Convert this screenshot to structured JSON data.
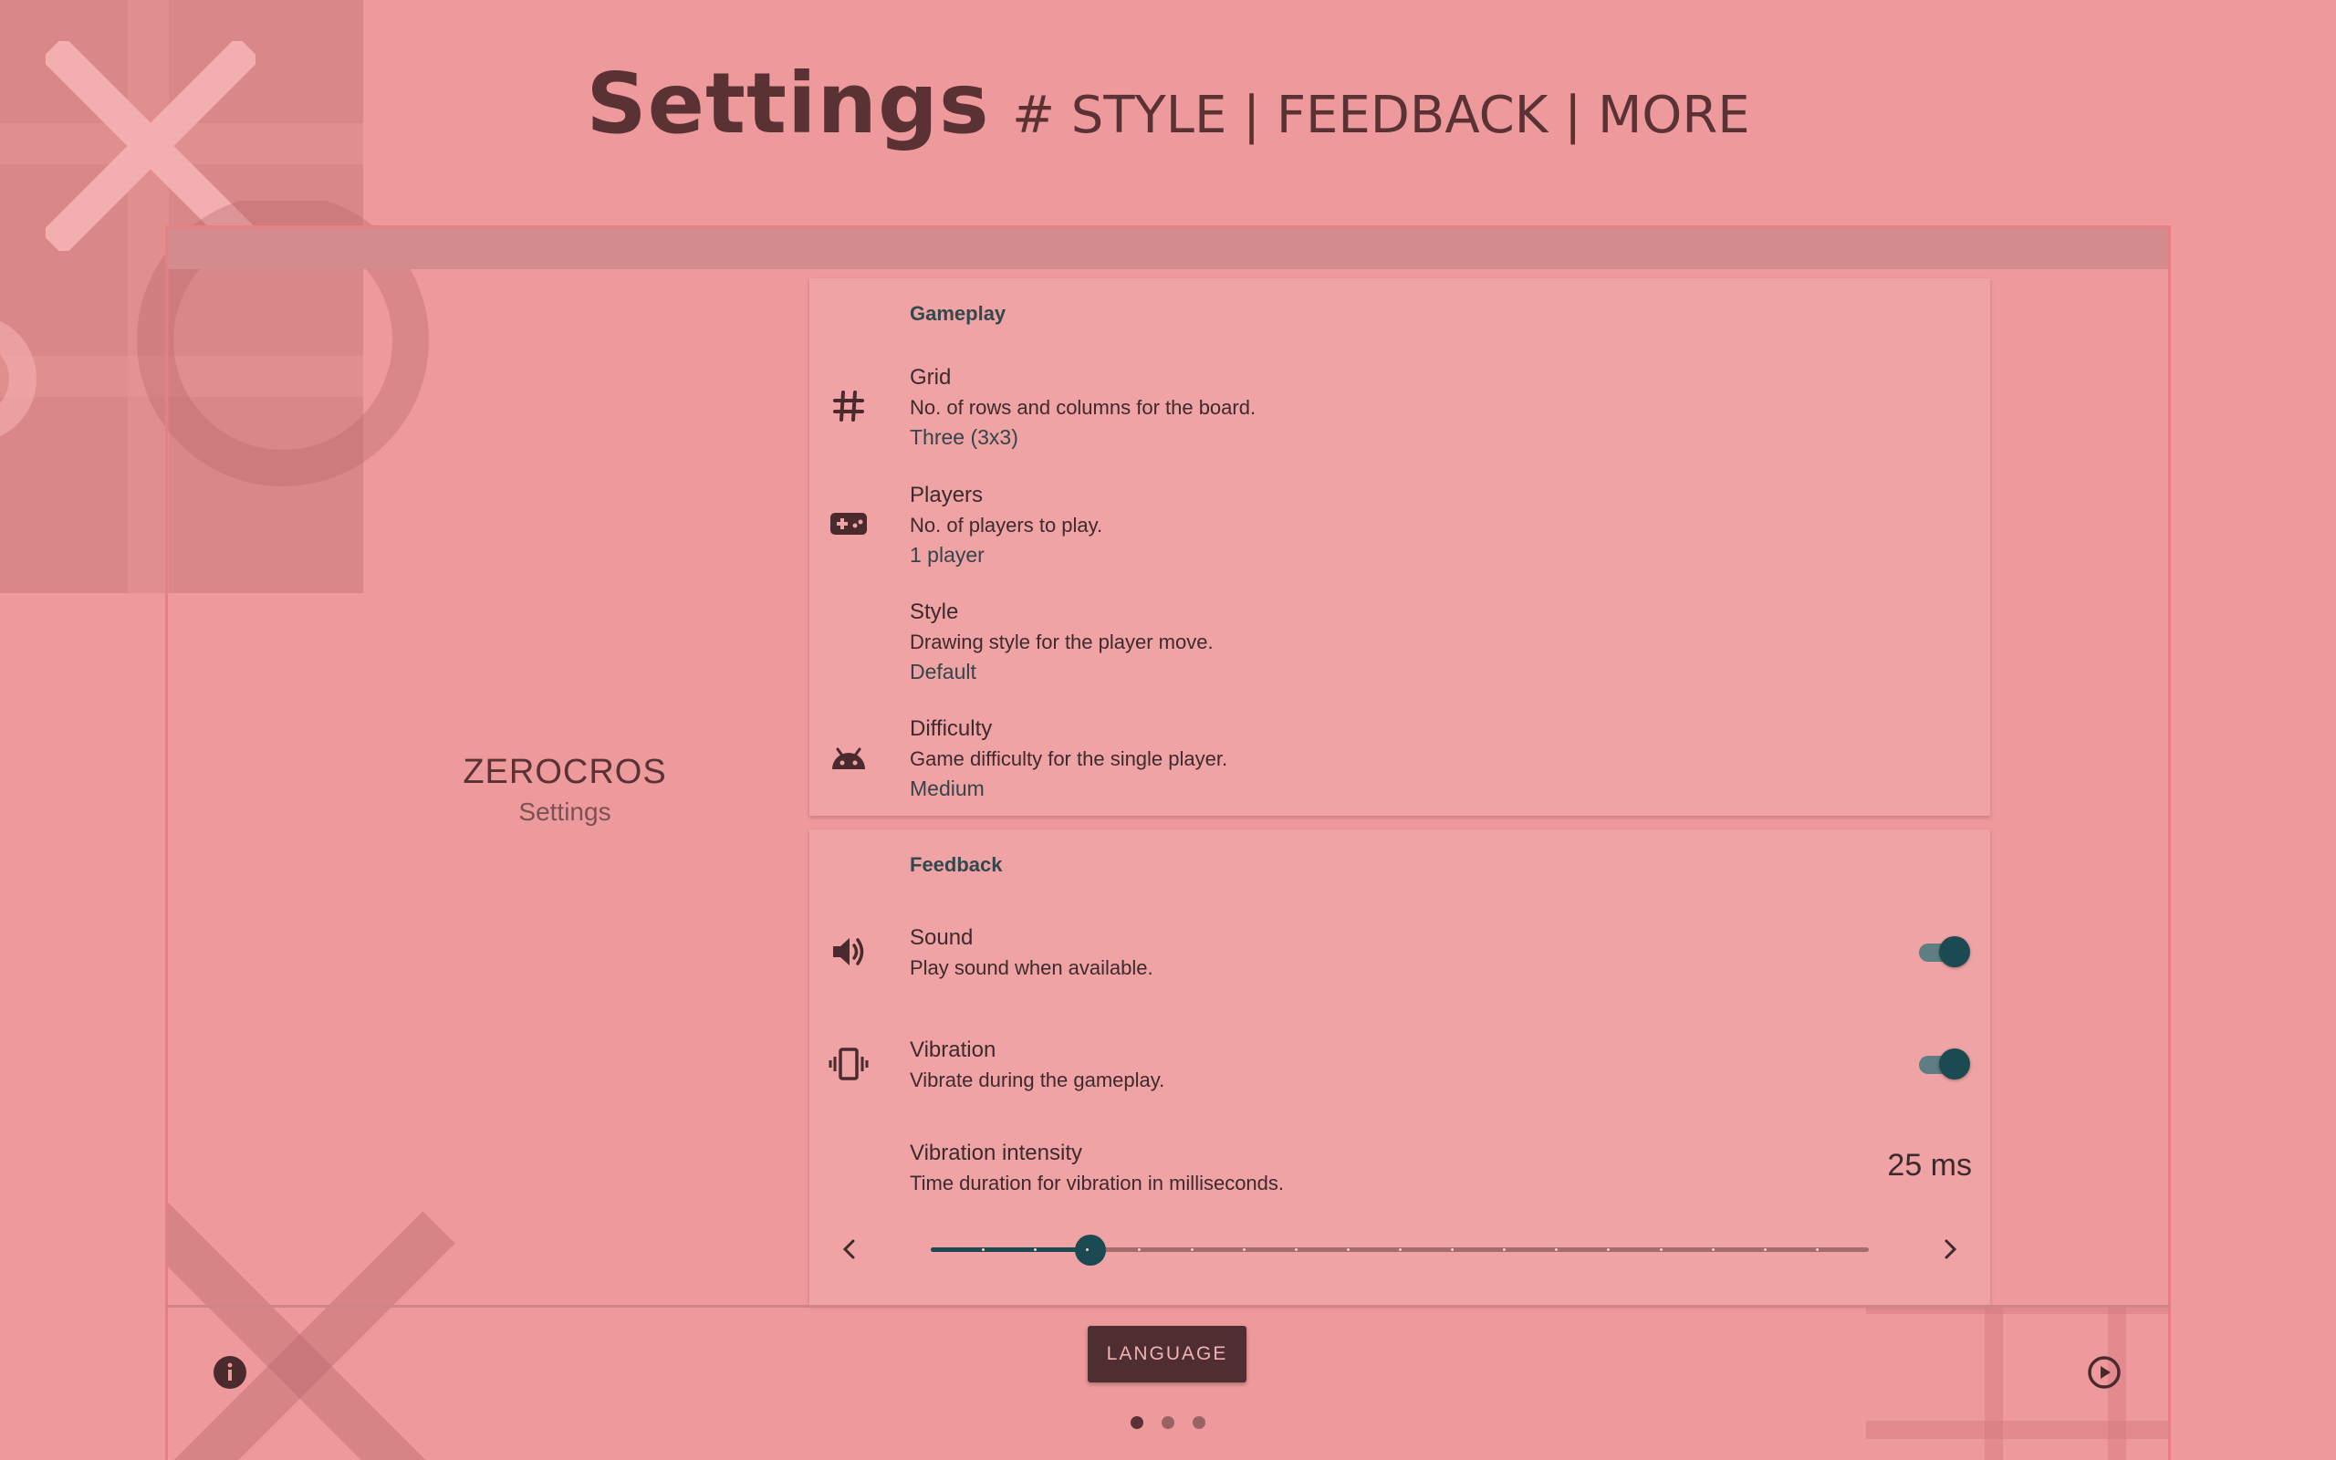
{
  "header": {
    "title": "Settings",
    "subtitle": "# STYLE | FEEDBACK | MORE"
  },
  "app": {
    "name": "ZEROCROS",
    "subtitle": "Settings"
  },
  "gameplay": {
    "header": "Gameplay",
    "items": [
      {
        "title": "Grid",
        "desc": "No. of rows and columns for the board.",
        "value": "Three (3x3)",
        "icon": "grid-hash-icon"
      },
      {
        "title": "Players",
        "desc": "No. of players to play.",
        "value": "1 player",
        "icon": "gamepad-icon"
      },
      {
        "title": "Style",
        "desc": "Drawing style for the player move.",
        "value": "Default",
        "icon": ""
      },
      {
        "title": "Difficulty",
        "desc": "Game difficulty for the single player.",
        "value": "Medium",
        "icon": "android-icon"
      }
    ]
  },
  "feedback": {
    "header": "Feedback",
    "sound": {
      "title": "Sound",
      "desc": "Play sound when available.",
      "enabled": true,
      "icon": "volume-icon"
    },
    "vibration": {
      "title": "Vibration",
      "desc": "Vibrate during the gameplay.",
      "enabled": true,
      "icon": "vibration-icon"
    },
    "intensity": {
      "title": "Vibration intensity",
      "desc": "Time duration for vibration in milliseconds.",
      "value_label": "25 ms",
      "position": 0.17,
      "steps": 18
    }
  },
  "footer": {
    "language_button": "LANGUAGE",
    "page_count": 3,
    "current_page": 0
  },
  "colors": {
    "background": "#ee9a9c",
    "accent": "#1b4a52",
    "card": "#efa3a4",
    "text": "#3e2a2c"
  }
}
